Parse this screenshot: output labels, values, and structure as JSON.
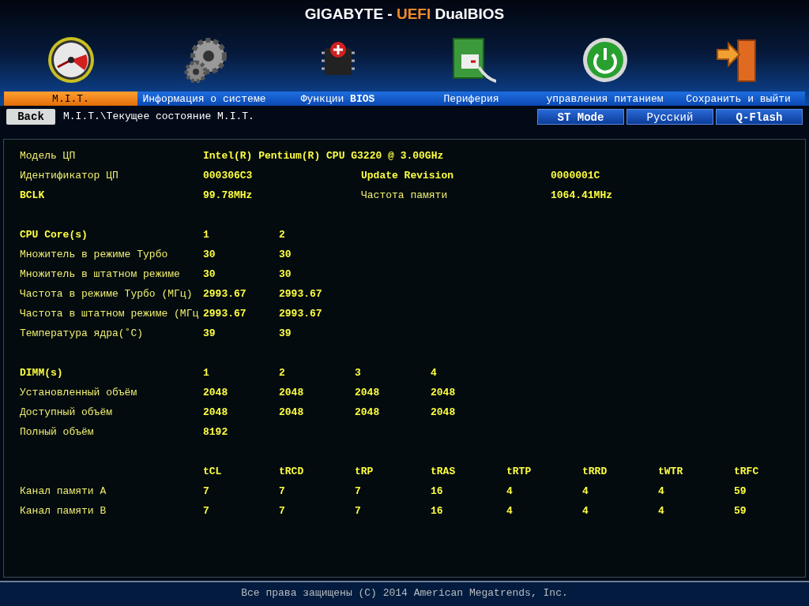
{
  "header": {
    "title_parts": [
      {
        "text": "GIGABYTE - ",
        "accent": false
      },
      {
        "text": "UEFI",
        "accent": true
      },
      {
        "text": " DualBIOS",
        "accent": false
      }
    ]
  },
  "nav_tabs": [
    {
      "label": "M.I.T.",
      "selected": true
    },
    {
      "label": "Информация о системе",
      "selected": false
    },
    {
      "label": "Функции **BIOS**",
      "selected": false
    },
    {
      "label": "Периферия",
      "selected": false
    },
    {
      "label": "управления питанием",
      "selected": false
    },
    {
      "label": "Сохранить и выйти",
      "selected": false
    }
  ],
  "toolbar": {
    "back_button": "Back",
    "breadcrumb": "M.I.T.\\Текущее состояние M.I.T.",
    "buttons": [
      "ST Mode",
      "Русский",
      "Q-Flash"
    ]
  },
  "cpu_info": [
    {
      "label": "Модель ЦП",
      "bold": false,
      "value": "Intel(R) Pentium(R) CPU G3220 @ 3.00GHz"
    },
    {
      "label": "Идентификатор ЦП",
      "bold": false,
      "value": "000306C3",
      "extra_label": "Update Revision",
      "extra_bold": true,
      "extra_value": "0000001C"
    },
    {
      "label": "BCLK",
      "bold": true,
      "value": "99.78MHz",
      "extra_label": "Частота памяти",
      "extra_bold": false,
      "extra_value": "1064.41MHz"
    }
  ],
  "cpu_cores": {
    "heading": "CPU Core(s)",
    "columns": [
      "1",
      "2"
    ],
    "rows": [
      {
        "label": "Множитель в режиме Турбо",
        "cells": [
          "30",
          "30"
        ]
      },
      {
        "label": "Множитель в штатном режиме",
        "cells": [
          "30",
          "30"
        ]
      },
      {
        "label": "Частота в режиме Турбо (МГц)",
        "cells": [
          "2993.67",
          "2993.67"
        ]
      },
      {
        "label": "Частота в штатном режиме (МГц",
        "cells": [
          "2993.67",
          "2993.67"
        ]
      },
      {
        "label": "Температура ядра(˚C)",
        "cells": [
          "39",
          "39"
        ]
      }
    ]
  },
  "dimms": {
    "heading": "DIMM(s)",
    "columns": [
      "1",
      "2",
      "3",
      "4"
    ],
    "rows": [
      {
        "label": "Установленный объём",
        "cells": [
          "2048",
          "2048",
          "2048",
          "2048"
        ]
      },
      {
        "label": "Доступный объём",
        "cells": [
          "2048",
          "2048",
          "2048",
          "2048"
        ]
      },
      {
        "label": "Полный объём",
        "cells": [
          "8192"
        ]
      }
    ]
  },
  "timings": {
    "columns": [
      "tCL",
      "tRCD",
      "tRP",
      "tRAS",
      "tRTP",
      "tRRD",
      "tWTR",
      "tRFC"
    ],
    "rows": [
      {
        "label": "Канал памяти A",
        "cells": [
          "7",
          "7",
          "7",
          "16",
          "4",
          "4",
          "4",
          "59"
        ]
      },
      {
        "label": "Канал памяти B",
        "cells": [
          "7",
          "7",
          "7",
          "16",
          "4",
          "4",
          "4",
          "59"
        ]
      }
    ]
  },
  "footer": "Все права защищены (C) 2014 American Megatrends, Inc."
}
